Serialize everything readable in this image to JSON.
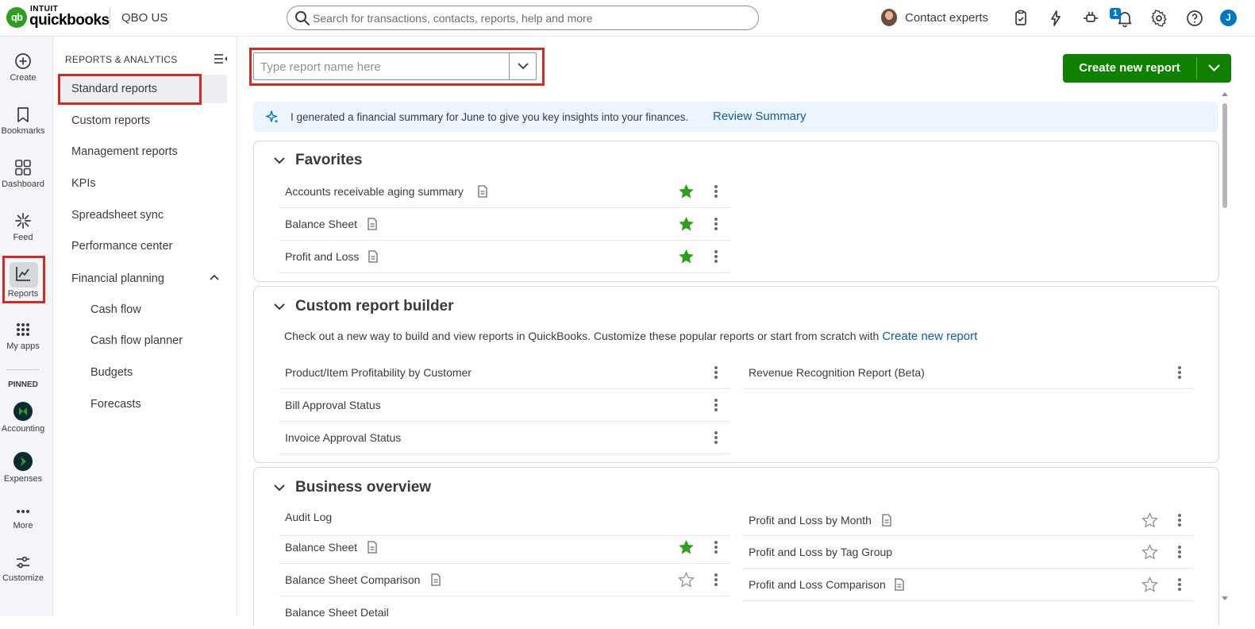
{
  "topbar": {
    "logo_intuit": "INTUIT",
    "logo_brand": "quickbooks",
    "logo_mark": "qb",
    "company": "QBO US",
    "search_placeholder": "Search for transactions, contacts, reports, help and more",
    "contact_experts": "Contact experts",
    "notification_count": "1",
    "user_initial": "J",
    "icons": [
      "clipboard-icon",
      "lightning-icon",
      "plug-icon",
      "bell-icon",
      "gear-icon",
      "help-icon"
    ]
  },
  "rail": {
    "items": [
      {
        "label": "Create",
        "icon": "plus-circle-icon"
      },
      {
        "label": "Bookmarks",
        "icon": "bookmark-icon"
      },
      {
        "label": "Dashboard",
        "icon": "dashboard-icon"
      },
      {
        "label": "Feed",
        "icon": "feed-icon"
      },
      {
        "label": "Reports",
        "icon": "reports-chart-icon"
      },
      {
        "label": "My apps",
        "icon": "apps-grid-icon"
      }
    ],
    "pinned_label": "PINNED",
    "pinned": [
      {
        "label": "Accounting",
        "icon": "accounting-icon"
      },
      {
        "label": "Expenses",
        "icon": "expenses-icon"
      }
    ],
    "more": "More",
    "customize": "Customize"
  },
  "subnav": {
    "header": "REPORTS & ANALYTICS",
    "items": [
      "Standard reports",
      "Custom reports",
      "Management reports",
      "KPIs",
      "Spreadsheet sync",
      "Performance center",
      "Financial planning"
    ],
    "sub_items": [
      "Cash flow",
      "Cash flow planner",
      "Budgets",
      "Forecasts"
    ]
  },
  "main": {
    "report_search_placeholder": "Type report name here",
    "create_button": "Create new report",
    "banner_text": "I generated a financial summary for June to give you key insights into your finances.",
    "banner_link": "Review Summary",
    "favorites": {
      "title": "Favorites",
      "rows": [
        "Accounts receivable aging summary",
        "Balance Sheet",
        "Profit and Loss"
      ]
    },
    "custom_builder": {
      "title": "Custom report builder",
      "desc": "Check out a new way to build and view reports in QuickBooks. Customize these popular reports or start from scratch with",
      "desc_link": "Create new report",
      "left_rows": [
        "Product/Item Profitability by Customer",
        "Bill Approval Status",
        "Invoice Approval Status"
      ],
      "right_rows": [
        "Revenue Recognition Report (Beta)"
      ]
    },
    "business_overview": {
      "title": "Business overview",
      "left_rows": [
        "Audit Log",
        "Balance Sheet",
        "Balance Sheet Comparison",
        "Balance Sheet Detail"
      ],
      "right_rows": [
        "Profit and Loss by Month",
        "Profit and Loss by Tag Group",
        "Profit and Loss Comparison"
      ]
    }
  },
  "colors": {
    "brand_green": "#2ca01c",
    "button_green": "#108000",
    "link_blue": "#0d5da8",
    "highlight_red": "#d52b1e",
    "star_green": "#2ca01c"
  }
}
